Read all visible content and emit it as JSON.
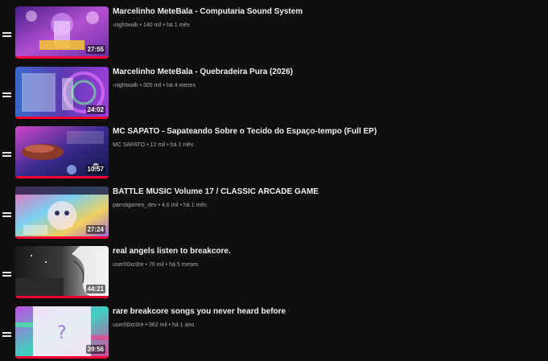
{
  "playlist": {
    "items": [
      {
        "title": "Marcelinho MeteBala - Computaria Sound System",
        "channel": "›nightwalk",
        "views": "140 mil",
        "age": "há 1 mês",
        "duration": "27:55",
        "progress": 1.0,
        "thumb_colors": [
          "#6b2fa8",
          "#c25bd9"
        ]
      },
      {
        "title": "Marcelinho MeteBala - Quebradeira Pura (2026)",
        "channel": "›nightwalk",
        "views": "305 mil",
        "age": "há 4 meses",
        "duration": "24:02",
        "progress": 1.0,
        "thumb_colors": [
          "#2a4fa0",
          "#8a3fc9"
        ]
      },
      {
        "title": "MC SAPATO - Sapateando Sobre o Tecido do Espaço-tempo (Full EP)",
        "channel": "MC SAPATO",
        "views": "12 mil",
        "age": "há 1 mês",
        "duration": "10:57",
        "progress": 1.0,
        "thumb_colors": [
          "#1a2a80",
          "#d048c8"
        ]
      },
      {
        "title": "BATTLE MUSIC Volume 17 / CLASSIC ARCADE GAME",
        "channel": "parrotgames_dev",
        "views": "4,6 mil",
        "age": "há 1 mês",
        "duration": "27:24",
        "progress": 1.0,
        "thumb_colors": [
          "#e65ab0",
          "#5ab0e6"
        ]
      },
      {
        "title": "real angels listen to breakcore.",
        "channel": "user00xc0re",
        "views": "76 mil",
        "age": "há 5 meses",
        "duration": "44:21",
        "progress": 1.0,
        "thumb_colors": [
          "#202020",
          "#d8d8d8"
        ]
      },
      {
        "title": "rare breakcore songs you never heard before",
        "channel": "user00xc0re",
        "views": "562 mil",
        "age": "há 1 ano",
        "duration": "39:56",
        "progress": 1.0,
        "thumb_colors": [
          "#b040d0",
          "#40d0c0"
        ]
      }
    ]
  },
  "colors": {
    "background": "#0f0f0f",
    "progress": "#ff0033",
    "meta_text": "#aaaaaa"
  }
}
